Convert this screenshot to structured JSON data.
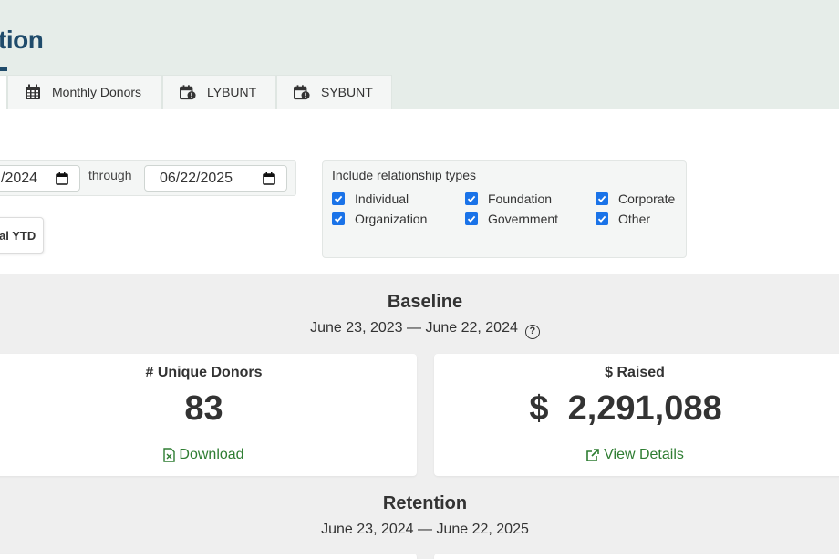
{
  "header": {
    "title": "tion",
    "tabs": [
      {
        "label": "Monthly Donors",
        "icon": "calendar-grid-icon"
      },
      {
        "label": "LYBUNT",
        "icon": "calendar-alert-icon"
      },
      {
        "label": "SYBUNT",
        "icon": "calendar-alert-icon"
      }
    ]
  },
  "filters": {
    "start_date": "/2024",
    "through_label": "through",
    "end_date": "06/22/2025",
    "ytd_button": "al YTD",
    "relationship": {
      "title": "Include relationship types",
      "options": [
        {
          "label": "Individual",
          "checked": true
        },
        {
          "label": "Foundation",
          "checked": true
        },
        {
          "label": "Corporate",
          "checked": true
        },
        {
          "label": "Organization",
          "checked": true
        },
        {
          "label": "Government",
          "checked": true
        },
        {
          "label": "Other",
          "checked": true
        }
      ]
    }
  },
  "baseline": {
    "title": "Baseline",
    "range": "June 23, 2023 — June 22, 2024",
    "donors_label": "# Unique Donors",
    "donors_value": "83",
    "download_label": "Download",
    "raised_label": "$ Raised",
    "raised_value": "$  2,291,088",
    "details_label": "View Details"
  },
  "retention": {
    "title": "Retention",
    "range": "June 23, 2024 — June 22, 2025"
  },
  "colors": {
    "header_bg": "#e6ede9",
    "title": "#1f4b6b",
    "checkbox": "#1a73e8",
    "link": "#2e7d32"
  }
}
